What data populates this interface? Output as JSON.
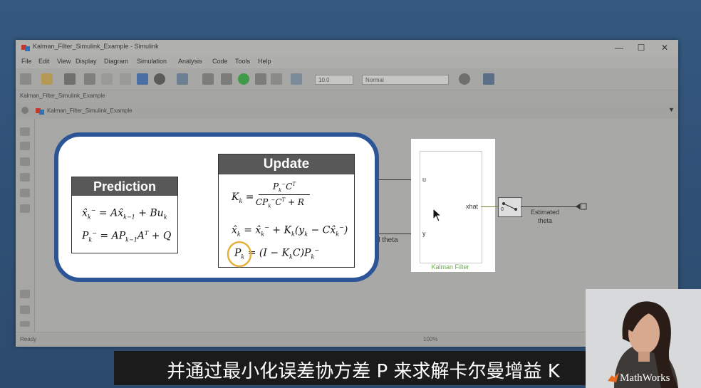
{
  "window": {
    "title": "Kalman_Filter_Simulink_Example - Simulink",
    "controls": [
      "—",
      "☐",
      "✕"
    ]
  },
  "menu": [
    "File",
    "Edit",
    "View",
    "Display",
    "Diagram",
    "Simulation",
    "Analysis",
    "Code",
    "Tools",
    "Help"
  ],
  "toolbar": {
    "stop_time": "10.0",
    "sim_mode": "Normal"
  },
  "tab": "Kalman_Filter_Simulink_Example",
  "breadcrumb": "Kalman_Filter_Simulink_Example",
  "status": {
    "left": "Ready",
    "zoom": "100%"
  },
  "callout": {
    "prediction_title": "Prediction",
    "update_title": "Update"
  },
  "diagram": {
    "block_label": "Kalman Filter",
    "port_u": "u",
    "port_y": "y",
    "port_xhat": "xhat",
    "signal_label_partial": "d theta",
    "output_label": "Estimated\ntheta",
    "switch_value": "0"
  },
  "subtitle": "并通过最小化误差协方差 P 来求解卡尔曼增益 K",
  "logo": "MathWorks",
  "colors": {
    "callout_border": "#2b5597",
    "highlight_circle": "#e3b23c",
    "block_label": "#6aa84f"
  }
}
